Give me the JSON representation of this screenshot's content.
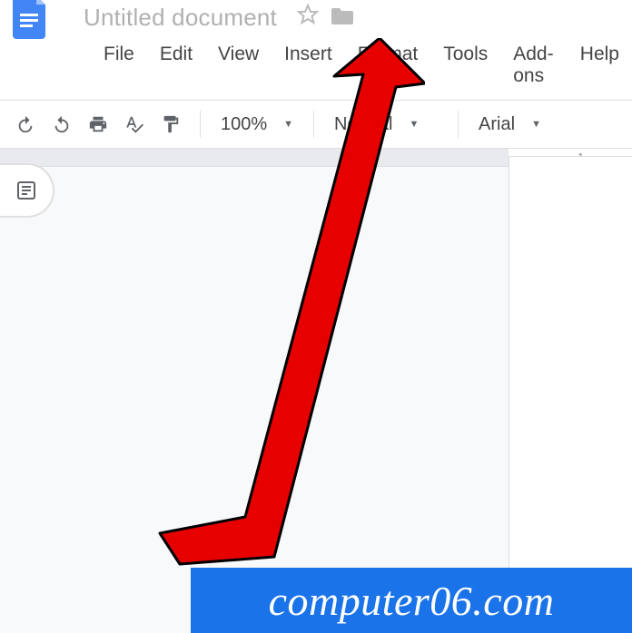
{
  "app": {
    "title": "Untitled document"
  },
  "menubar": {
    "items": [
      "File",
      "Edit",
      "View",
      "Insert",
      "Format",
      "Tools",
      "Add-ons",
      "Help"
    ]
  },
  "toolbar": {
    "zoom": "100%",
    "style": "Normal",
    "font": "Arial"
  },
  "ruler": {
    "mark1": "1"
  },
  "watermark": "computer06.com"
}
